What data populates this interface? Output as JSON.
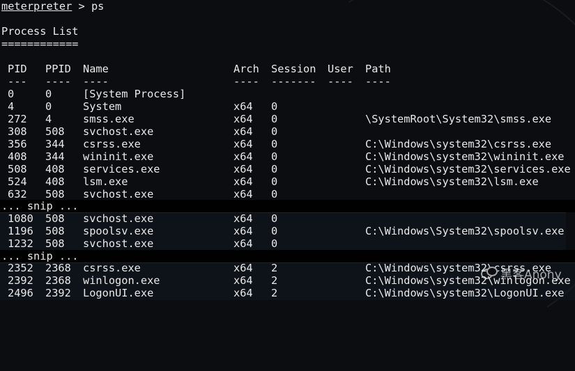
{
  "terminal": {
    "prompt_word": "meterpreter",
    "prompt_rest": " > ps",
    "title": "Process List",
    "title_underline": "============",
    "headers": [
      "PID",
      "PPID",
      "Name",
      "Arch",
      "Session",
      "User",
      "Path"
    ],
    "header_dashes": [
      "---",
      "----",
      "----",
      "----",
      "-------",
      "----",
      "----"
    ],
    "snip": "... snip ...",
    "group1": [
      [
        "0",
        "0",
        "[System Process]",
        "",
        "",
        "",
        ""
      ],
      [
        "4",
        "0",
        "System",
        "x64",
        "0",
        "",
        ""
      ],
      [
        "272",
        "4",
        "smss.exe",
        "x64",
        "0",
        "",
        "\\SystemRoot\\System32\\smss.exe"
      ],
      [
        "308",
        "508",
        "svchost.exe",
        "x64",
        "0",
        "",
        ""
      ],
      [
        "356",
        "344",
        "csrss.exe",
        "x64",
        "0",
        "",
        "C:\\Windows\\system32\\csrss.exe"
      ],
      [
        "408",
        "344",
        "wininit.exe",
        "x64",
        "0",
        "",
        "C:\\Windows\\system32\\wininit.exe"
      ],
      [
        "508",
        "408",
        "services.exe",
        "x64",
        "0",
        "",
        "C:\\Windows\\system32\\services.exe"
      ],
      [
        "524",
        "408",
        "lsm.exe",
        "x64",
        "0",
        "",
        "C:\\Windows\\system32\\lsm.exe"
      ],
      [
        "632",
        "508",
        "svchost.exe",
        "x64",
        "0",
        "",
        ""
      ]
    ],
    "group2": [
      [
        "1080",
        "508",
        "svchost.exe",
        "x64",
        "0",
        "",
        ""
      ],
      [
        "1196",
        "508",
        "spoolsv.exe",
        "x64",
        "0",
        "",
        "C:\\Windows\\System32\\spoolsv.exe"
      ],
      [
        "1232",
        "508",
        "svchost.exe",
        "x64",
        "0",
        "",
        ""
      ]
    ],
    "group3": [
      [
        "2352",
        "2368",
        "csrss.exe",
        "x64",
        "2",
        "",
        "C:\\Windows\\system32\\csrss.exe"
      ],
      [
        "2392",
        "2368",
        "winlogon.exe",
        "x64",
        "2",
        "",
        "C:\\Windows\\system32\\winlogon.exe"
      ],
      [
        "2496",
        "2392",
        "LogonUI.exe",
        "x64",
        "2",
        "",
        "C:\\Windows\\system32\\LogonUI.exe"
      ]
    ]
  },
  "watermark": {
    "text": "黑客Anony",
    "icon": "wechat-icon"
  },
  "colors": {
    "background": "#0b0d10",
    "text": "#e9e9e9"
  }
}
